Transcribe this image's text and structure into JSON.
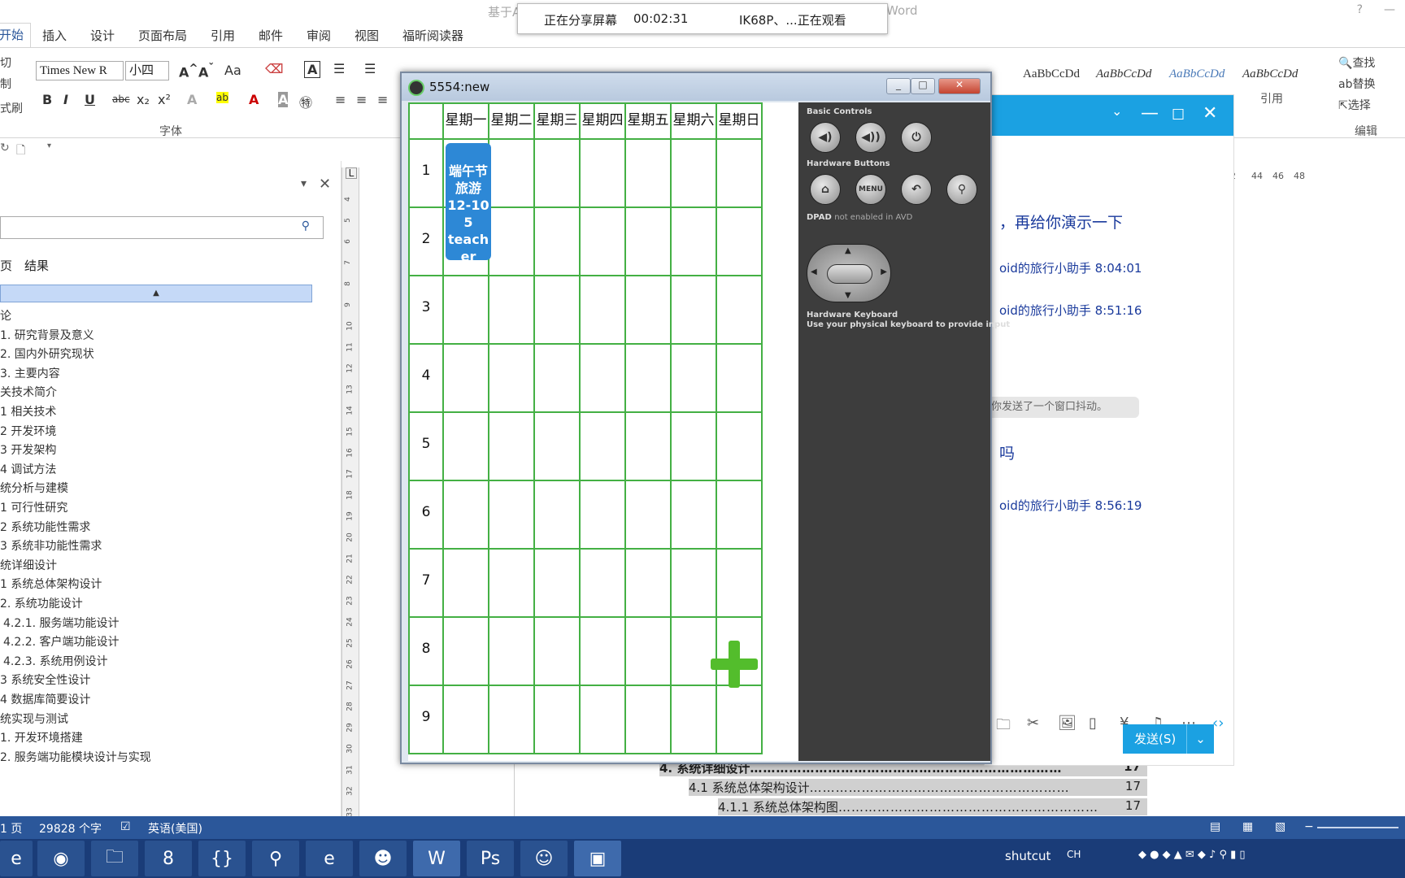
{
  "word": {
    "title_fragment_left": "基于A",
    "title_fragment_right": "Word",
    "help": "?",
    "tabs": [
      "开始",
      "插入",
      "设计",
      "页面布局",
      "引用",
      "邮件",
      "审阅",
      "视图",
      "福昕阅读器"
    ],
    "clipboard": [
      "切",
      "制",
      "式刷"
    ],
    "font_name": "Times New R",
    "font_size": "小四",
    "group_font_label": "字体",
    "styles": [
      "AaBbCcDd",
      "AaBbCcDd",
      "AaBbCcDd",
      "AaBbCcDd"
    ],
    "style_label": "引用",
    "edit": {
      "find": "查找",
      "replace": "替换",
      "select": "选择",
      "group": "编辑"
    },
    "nav": {
      "tab_pages": "页",
      "tab_results": "结果",
      "items": [
        "论",
        "1. 研究背景及意义",
        "2. 国内外研究现状",
        "3. 主要内容",
        "关技术简介",
        "1 相关技术",
        "2 开发环境",
        "3 开发架构",
        "4 调试方法",
        "统分析与建模",
        "1 可行性研究",
        "2 系统功能性需求",
        "3 系统非功能性需求",
        "统详细设计",
        "1 系统总体架构设计",
        "2. 系统功能设计",
        "4.2.1. 服务端功能设计",
        "4.2.2. 客户端功能设计",
        "4.2.3. 系统用例设计",
        "3 系统安全性设计",
        "4 数据库简要设计",
        "统实现与测试",
        "1. 开发环境搭建",
        "2. 服务端功能模块设计与实现"
      ]
    },
    "ruler_ticks": [
      "4",
      "5",
      "6",
      "7",
      "8",
      "9",
      "10",
      "11",
      "12",
      "13",
      "14",
      "15",
      "16",
      "17",
      "18",
      "19",
      "20",
      "21",
      "22",
      "23",
      "24",
      "25",
      "26",
      "27",
      "28",
      "29",
      "30",
      "31",
      "32",
      "33"
    ],
    "hruler_ticks": [
      "2",
      "44",
      "46",
      "48"
    ],
    "toc": [
      {
        "text": "4.  系统详细设计",
        "page": "17"
      },
      {
        "text": "4.1  系统总体架构设计",
        "page": "17"
      },
      {
        "text": "4.1.1  系统总体架构图",
        "page": "17"
      }
    ],
    "status": {
      "page": "1 页",
      "words": "29828 个字",
      "lang": "英语(美国)"
    }
  },
  "share_bar": {
    "status": "正在分享屏幕",
    "timer": "00:02:31",
    "viewer": "IK68P、...正在观看"
  },
  "chat": {
    "messages": [
      {
        "text": "，再给你演示一下"
      },
      {
        "text": "oid的旅行小助手  8:04:01"
      },
      {
        "text": "oid的旅行小助手  8:51:16"
      },
      {
        "text": "你发送了一个窗口抖动。"
      },
      {
        "text": "吗"
      },
      {
        "text": "oid的旅行小助手  8:56:19"
      }
    ],
    "send_label": "发送(S)"
  },
  "emulator": {
    "title": "5554:new",
    "days": [
      "星期一",
      "星期二",
      "星期三",
      "星期四",
      "星期五",
      "星期六",
      "星期日"
    ],
    "periods": [
      "1",
      "2",
      "3",
      "4",
      "5",
      "6",
      "7",
      "8",
      "9"
    ],
    "course": {
      "name": "端午节旅游",
      "room": "12-105",
      "teacher": "teacher",
      "day": "星期一",
      "periods": [
        "1",
        "2"
      ]
    },
    "panel": {
      "basic_controls": "Basic Controls",
      "hardware_buttons": "Hardware Buttons",
      "dpad_label": "DPAD",
      "dpad_note": "not enabled in AVD",
      "keyboard_title": "Hardware Keyboard",
      "keyboard_note": "Use your physical keyboard to provide input",
      "menu_label": "MENU"
    }
  },
  "taskbar": {
    "tray_text": "shutcut",
    "ime": "CH"
  }
}
